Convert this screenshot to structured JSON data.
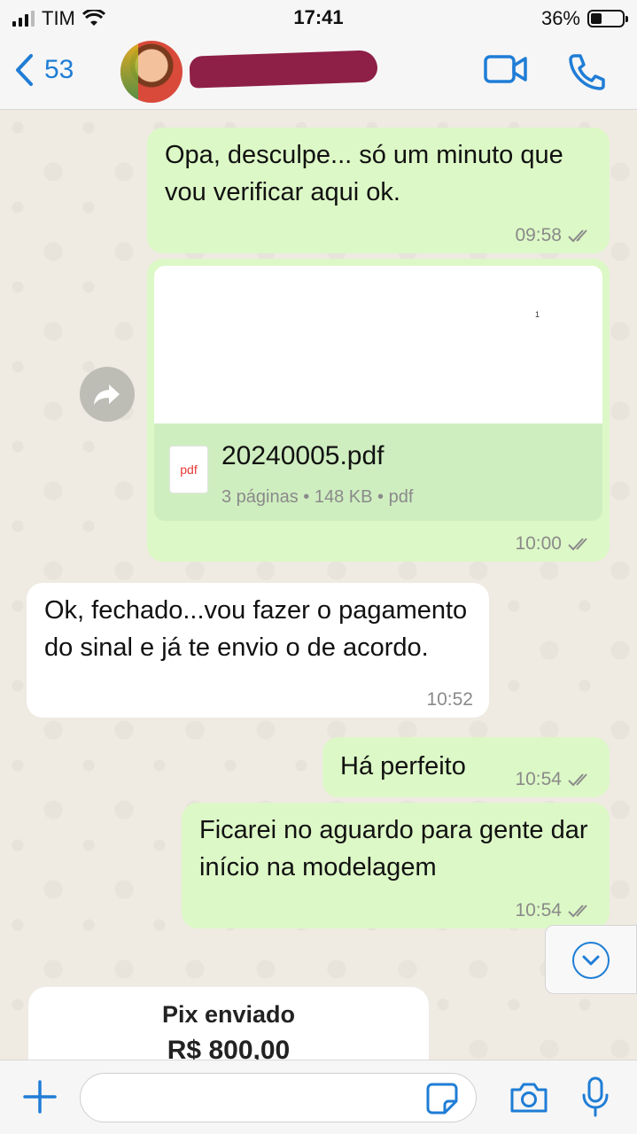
{
  "status_bar": {
    "carrier": "TIM",
    "time": "17:41",
    "battery": "36%",
    "battery_level": 0.36
  },
  "header": {
    "back_count": "53",
    "icons": [
      "chevron-left-icon",
      "video-call-icon",
      "phone-icon"
    ]
  },
  "messages": [
    {
      "direction": "outgoing",
      "text": "Opa, desculpe... só um minuto que vou verificar aqui ok.",
      "time": "09:58"
    },
    {
      "direction": "outgoing",
      "type": "document",
      "preview_page": "1",
      "doc_icon": "pdf",
      "file_name": "20240005.pdf",
      "file_meta": "3 páginas • 148 KB • pdf",
      "time": "10:00"
    },
    {
      "direction": "incoming",
      "text": "Ok, fechado...vou fazer o pagamento do sinal e já te envio o de acordo.",
      "time": "10:52"
    },
    {
      "direction": "outgoing",
      "text": "Há perfeito",
      "time": "10:54"
    },
    {
      "direction": "outgoing",
      "text": "Ficarei no aguardo para gente dar início na modelagem",
      "time": "10:54"
    }
  ],
  "pix_card": {
    "title": "Pix enviado",
    "amount": "R$ 800,00"
  },
  "colors": {
    "accent": "#1f7dd6",
    "outgoing_bubble": "#dcf8c6",
    "incoming_bubble": "#ffffff",
    "chat_bg": "#efeae2",
    "redaction": "#8e1f46"
  }
}
